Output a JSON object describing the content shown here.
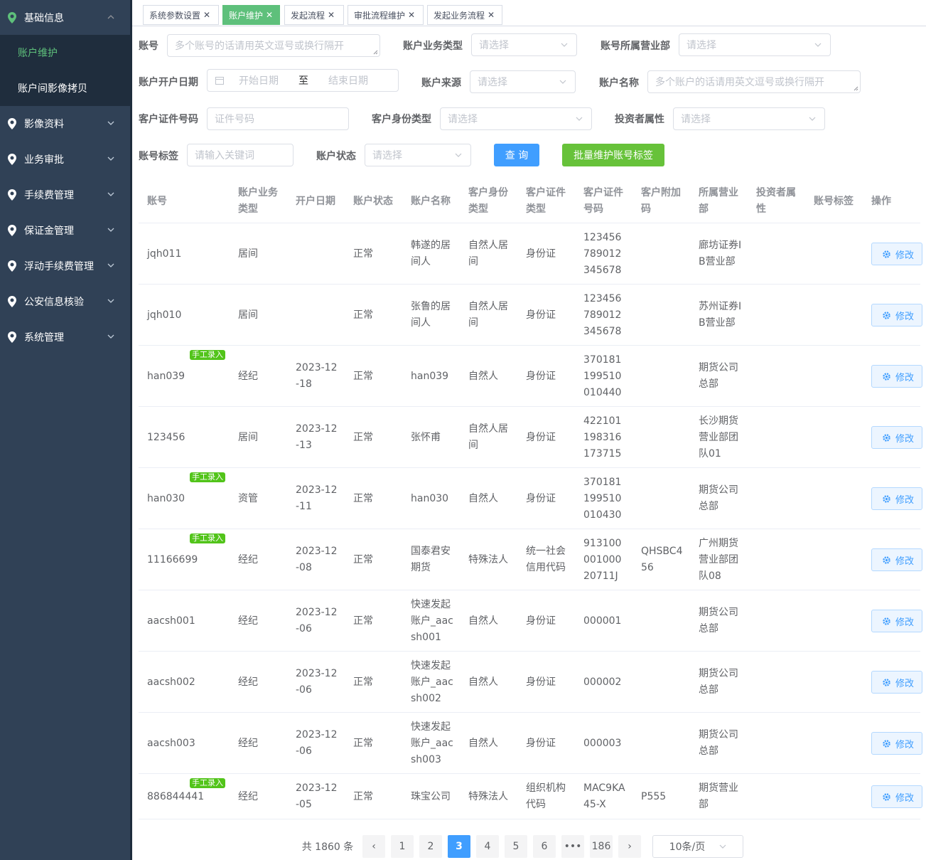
{
  "sidebar": {
    "items": [
      {
        "label": "基础信息",
        "expanded": true
      },
      {
        "label": "影像资料"
      },
      {
        "label": "业务审批"
      },
      {
        "label": "手续费管理"
      },
      {
        "label": "保证金管理"
      },
      {
        "label": "浮动手续费管理"
      },
      {
        "label": "公安信息核验"
      },
      {
        "label": "系统管理"
      }
    ],
    "subitems": [
      {
        "label": "账户维护",
        "active": true
      },
      {
        "label": "账户间影像拷贝"
      }
    ]
  },
  "tabs": [
    {
      "label": "系统参数设置",
      "active": false
    },
    {
      "label": "账户维护",
      "active": true
    },
    {
      "label": "发起流程",
      "active": false
    },
    {
      "label": "审批流程维护",
      "active": false
    },
    {
      "label": "发起业务流程",
      "active": false
    }
  ],
  "filters": {
    "account": {
      "label": "账号",
      "placeholder": "多个账号的话请用英文逗号或换行隔开"
    },
    "biz_type": {
      "label": "账户业务类型",
      "placeholder": "请选择"
    },
    "branch": {
      "label": "账号所属营业部",
      "placeholder": "请选择"
    },
    "open_date": {
      "label": "账户开户日期",
      "start": "开始日期",
      "sep": "至",
      "end": "结束日期"
    },
    "source": {
      "label": "账户来源",
      "placeholder": "请选择"
    },
    "name": {
      "label": "账户名称",
      "placeholder": "多个账户的话请用英文逗号或换行隔开"
    },
    "id_no": {
      "label": "客户证件号码",
      "placeholder": "证件号码"
    },
    "id_type": {
      "label": "客户身份类型",
      "placeholder": "请选择"
    },
    "investor": {
      "label": "投资者属性",
      "placeholder": "请选择"
    },
    "acct_tag": {
      "label": "账号标签",
      "placeholder": "请输入关键词"
    },
    "status": {
      "label": "账户状态",
      "placeholder": "请选择"
    },
    "query_button": "查 询",
    "batch_button": "批量维护账号标签"
  },
  "table": {
    "headers": [
      "账号",
      "账户业务类型",
      "开户日期",
      "账户状态",
      "账户名称",
      "客户身份类型",
      "客户证件类型",
      "客户证件号码",
      "客户附加码",
      "所属营业部",
      "投资者属性",
      "账号标签",
      "操作"
    ],
    "badge_text": "手工录入",
    "edit_label": "修改",
    "rows": [
      {
        "account": "jqh011",
        "type": "居间",
        "date": "",
        "status": "正常",
        "name": "韩遂的居间人",
        "id_type": "自然人居间",
        "cert_type": "身份证",
        "cert_no": "123456789012345678",
        "extra": "",
        "branch": "廊坊证券IB营业部",
        "investor": "",
        "tag": "",
        "manual": false
      },
      {
        "account": "jqh010",
        "type": "居间",
        "date": "",
        "status": "正常",
        "name": "张鲁的居间人",
        "id_type": "自然人居间",
        "cert_type": "身份证",
        "cert_no": "123456789012345678",
        "extra": "",
        "branch": "苏州证券IB营业部",
        "investor": "",
        "tag": "",
        "manual": false
      },
      {
        "account": "han039",
        "type": "经纪",
        "date": "2023-12-18",
        "status": "正常",
        "name": "han039",
        "id_type": "自然人",
        "cert_type": "身份证",
        "cert_no": "370181199510010440",
        "extra": "",
        "branch": "期货公司总部",
        "investor": "",
        "tag": "",
        "manual": true
      },
      {
        "account": "123456",
        "type": "居间",
        "date": "2023-12-13",
        "status": "正常",
        "name": "张怀甫",
        "id_type": "自然人居间",
        "cert_type": "身份证",
        "cert_no": "422101198316173715",
        "extra": "",
        "branch": "长沙期货营业部团队01",
        "investor": "",
        "tag": "",
        "manual": false
      },
      {
        "account": "han030",
        "type": "资管",
        "date": "2023-12-11",
        "status": "正常",
        "name": "han030",
        "id_type": "自然人",
        "cert_type": "身份证",
        "cert_no": "370181199510010430",
        "extra": "",
        "branch": "期货公司总部",
        "investor": "",
        "tag": "",
        "manual": true
      },
      {
        "account": "11166699",
        "type": "经纪",
        "date": "2023-12-08",
        "status": "正常",
        "name": "国泰君安期货",
        "id_type": "特殊法人",
        "cert_type": "统一社会信用代码",
        "cert_no": "91310000100020711J",
        "extra": "QHSBC456",
        "branch": "广州期货营业部团队08",
        "investor": "",
        "tag": "",
        "manual": true
      },
      {
        "account": "aacsh001",
        "type": "经纪",
        "date": "2023-12-06",
        "status": "正常",
        "name": "快速发起账户_aacsh001",
        "id_type": "自然人",
        "cert_type": "身份证",
        "cert_no": "000001",
        "extra": "",
        "branch": "期货公司总部",
        "investor": "",
        "tag": "",
        "manual": false
      },
      {
        "account": "aacsh002",
        "type": "经纪",
        "date": "2023-12-06",
        "status": "正常",
        "name": "快速发起账户_aacsh002",
        "id_type": "自然人",
        "cert_type": "身份证",
        "cert_no": "000002",
        "extra": "",
        "branch": "期货公司总部",
        "investor": "",
        "tag": "",
        "manual": false
      },
      {
        "account": "aacsh003",
        "type": "经纪",
        "date": "2023-12-06",
        "status": "正常",
        "name": "快速发起账户_aacsh003",
        "id_type": "自然人",
        "cert_type": "身份证",
        "cert_no": "000003",
        "extra": "",
        "branch": "期货公司总部",
        "investor": "",
        "tag": "",
        "manual": false
      },
      {
        "account": "886844441",
        "type": "经纪",
        "date": "2023-12-05",
        "status": "正常",
        "name": "珠宝公司",
        "id_type": "特殊法人",
        "cert_type": "组织机构代码",
        "cert_no": "MAC9KA45-X",
        "extra": "P555",
        "branch": "期货营业部",
        "investor": "",
        "tag": "",
        "manual": true
      }
    ]
  },
  "pagination": {
    "total_text": "共 1860 条",
    "prev": "‹",
    "next": "›",
    "pages": [
      "1",
      "2",
      "3",
      "4",
      "5",
      "6",
      "•••",
      "186"
    ],
    "current": "3",
    "page_size": "10条/页"
  },
  "colors": {
    "accent": "#409eff",
    "success": "#67c23a",
    "active_menu": "#5ec07b",
    "sidebar_bg": "#304156"
  }
}
